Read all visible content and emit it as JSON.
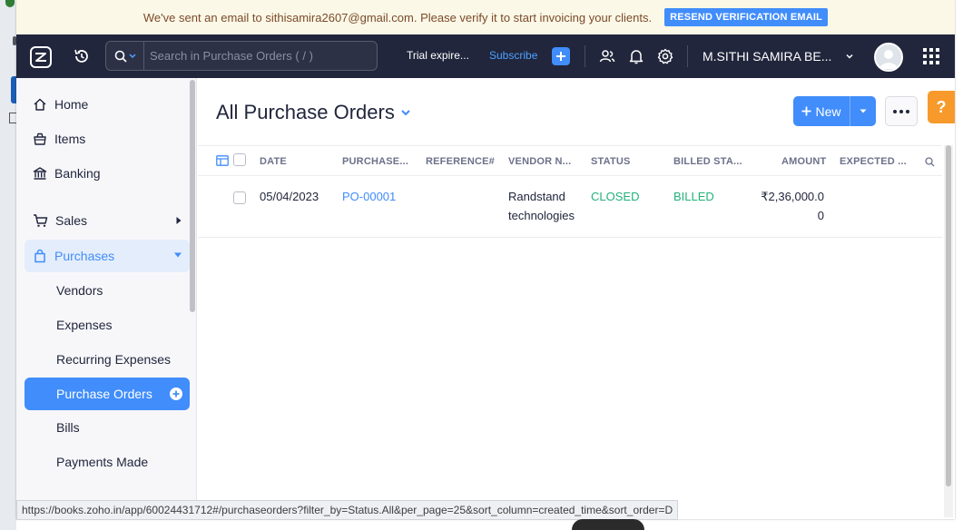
{
  "notice": {
    "text": "We've sent an email to sithisamira2607@gmail.com. Please verify it to start invoicing your clients.",
    "button": "RESEND VERIFICATION EMAIL"
  },
  "topbar": {
    "search_placeholder": "Search in Purchase Orders ( / )",
    "trial": "Trial expire...",
    "subscribe": "Subscribe",
    "user": "M.SITHI SAMIRA BE..."
  },
  "sidebar": {
    "home": "Home",
    "items": "Items",
    "banking": "Banking",
    "sales": "Sales",
    "purchases": "Purchases",
    "vendors": "Vendors",
    "expenses": "Expenses",
    "recurring_expenses": "Recurring Expenses",
    "purchase_orders": "Purchase Orders",
    "bills": "Bills",
    "payments_made": "Payments Made"
  },
  "main": {
    "title": "All Purchase Orders",
    "new_label": "New",
    "help": "?",
    "columns": {
      "date": "DATE",
      "purchase": "PURCHASE...",
      "reference": "REFERENCE#",
      "vendor": "VENDOR N...",
      "status": "STATUS",
      "billed": "BILLED STA...",
      "amount": "AMOUNT",
      "expected": "EXPECTED ..."
    },
    "rows": [
      {
        "date": "05/04/2023",
        "po": "PO-00001",
        "reference": "",
        "vendor_line1": "Randstand",
        "vendor_line2": "technologies",
        "status": "CLOSED",
        "billed": "BILLED",
        "amount_line1": "₹2,36,000.0",
        "amount_line2": "0",
        "expected": ""
      }
    ]
  },
  "statusbar": {
    "url": "https://books.zoho.in/app/60024431712#/purchaseorders?filter_by=Status.All&per_page=25&sort_column=created_time&sort_order=D"
  },
  "colors": {
    "accent": "#408dfb",
    "topbar": "#21263c",
    "notice_bg": "#fbf8e7",
    "success": "#22b378",
    "help": "#f79a2b"
  }
}
